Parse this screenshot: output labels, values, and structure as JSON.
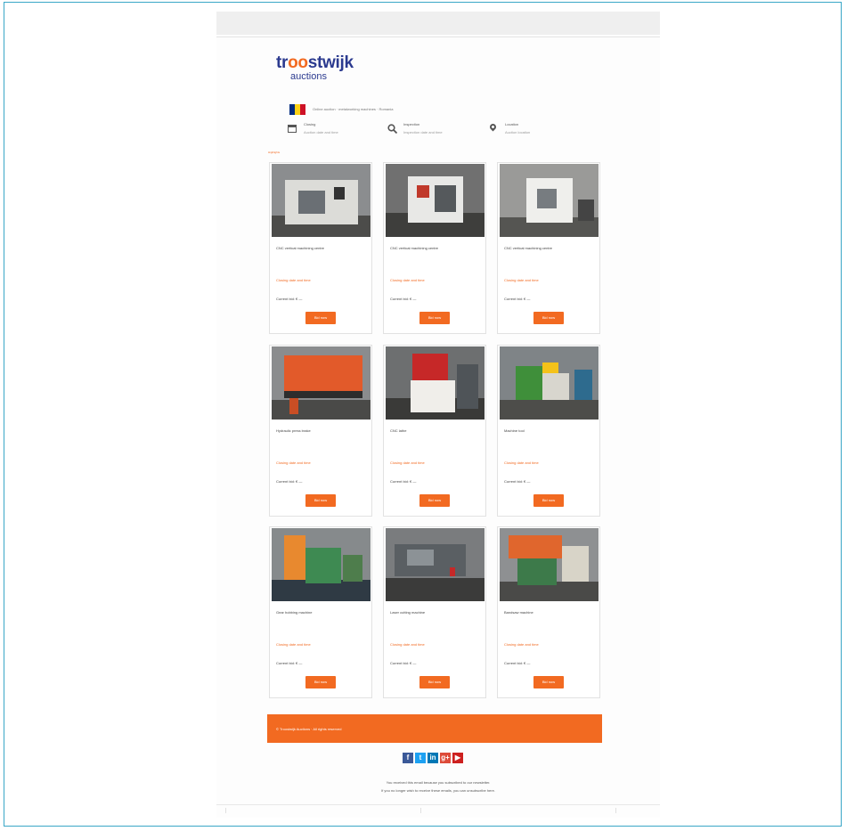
{
  "brand": {
    "logo_main_a": "tr",
    "logo_main_oo": "oo",
    "logo_main_b": "stwijk",
    "logo_sub": "auctions",
    "accent_color": "#f26a21",
    "logo_color": "#2b3a8f"
  },
  "intro": {
    "flag_colors": [
      "#002b7f",
      "#fcd116",
      "#ce1126"
    ],
    "text": "Online auction · metalworking machines · Romania"
  },
  "info": [
    {
      "icon": "calendar-icon",
      "label": "Closing",
      "value": "Auction date and time"
    },
    {
      "icon": "search-icon",
      "label": "Inspection",
      "value": "Inspection date and time"
    },
    {
      "icon": "location-pin-icon",
      "label": "Location",
      "value": "Auction location"
    }
  ],
  "section_label": "Highlights",
  "lots": [
    {
      "title": "CNC vertical machining centre",
      "date": "Closing date and time",
      "price": "Current bid: € —",
      "button": "Bid now"
    },
    {
      "title": "CNC vertical machining centre",
      "date": "Closing date and time",
      "price": "Current bid: € —",
      "button": "Bid now"
    },
    {
      "title": "CNC vertical machining centre",
      "date": "Closing date and time",
      "price": "Current bid: € —",
      "button": "Bid now"
    },
    {
      "title": "Hydraulic press brake",
      "date": "Closing date and time",
      "price": "Current bid: € —",
      "button": "Bid now"
    },
    {
      "title": "CNC lathe",
      "date": "Closing date and time",
      "price": "Current bid: € —",
      "button": "Bid now"
    },
    {
      "title": "Machine tool",
      "date": "Closing date and time",
      "price": "Current bid: € —",
      "button": "Bid now"
    },
    {
      "title": "Gear hobbing machine",
      "date": "Closing date and time",
      "price": "Current bid: € —",
      "button": "Bid now"
    },
    {
      "title": "Laser cutting machine",
      "date": "Closing date and time",
      "price": "Current bid: € —",
      "button": "Bid now"
    },
    {
      "title": "Bandsaw machine",
      "date": "Closing date and time",
      "price": "Current bid: € —",
      "button": "Bid now"
    }
  ],
  "footer": {
    "copyright": "© Troostwijk Auctions · All rights reserved"
  },
  "social": [
    {
      "icon": "facebook-icon",
      "glyph": "f",
      "color": "#3b5998"
    },
    {
      "icon": "twitter-icon",
      "glyph": "t",
      "color": "#1da1f2"
    },
    {
      "icon": "linkedin-icon",
      "glyph": "in",
      "color": "#0077b5"
    },
    {
      "icon": "google-plus-icon",
      "glyph": "g+",
      "color": "#dd4b39"
    },
    {
      "icon": "youtube-icon",
      "glyph": "▶",
      "color": "#cd201f"
    }
  ],
  "unsubscribe": {
    "line1": "You received this email because you subscribed to our newsletter.",
    "line2": "If you no longer wish to receive these emails, you can unsubscribe here."
  }
}
